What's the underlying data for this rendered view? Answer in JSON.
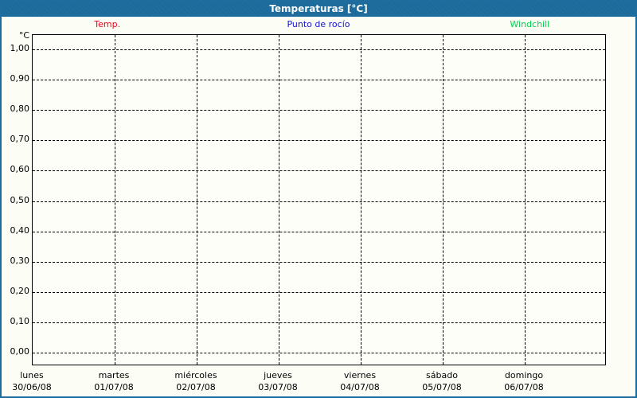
{
  "window": {
    "title": "Temperaturas [°C]",
    "titlebar_color": "#1e6d9e",
    "background_color": "#fcfdf5"
  },
  "legend": {
    "items": [
      {
        "label": "Temp.",
        "color": "#f50021"
      },
      {
        "label": "Punto de rocío",
        "color": "#1414cd"
      },
      {
        "label": "Windchill",
        "color": "#00d24e"
      }
    ]
  },
  "chart_data": {
    "type": "line",
    "title": "Temperaturas [°C]",
    "unit_label": "°C",
    "grid": "dashed",
    "legend_position": "top",
    "y_axis": {
      "min": 0.0,
      "max": 1.0,
      "step": 0.1,
      "tick_labels": [
        "1,00",
        "0,90",
        "0,80",
        "0,70",
        "0,60",
        "0,50",
        "0,40",
        "0,30",
        "0,20",
        "0,10",
        "0,00"
      ]
    },
    "x_axis": {
      "days": [
        {
          "name": "lunes",
          "date": "30/06/08"
        },
        {
          "name": "martes",
          "date": "01/07/08"
        },
        {
          "name": "miércoles",
          "date": "02/07/08"
        },
        {
          "name": "jueves",
          "date": "03/07/08"
        },
        {
          "name": "viernes",
          "date": "04/07/08"
        },
        {
          "name": "sábado",
          "date": "05/07/08"
        },
        {
          "name": "domingo",
          "date": "06/07/08"
        }
      ]
    },
    "series": [
      {
        "name": "Temp.",
        "color": "#f50021",
        "values": []
      },
      {
        "name": "Punto de rocío",
        "color": "#1414cd",
        "values": []
      },
      {
        "name": "Windchill",
        "color": "#00d24e",
        "values": []
      }
    ]
  }
}
